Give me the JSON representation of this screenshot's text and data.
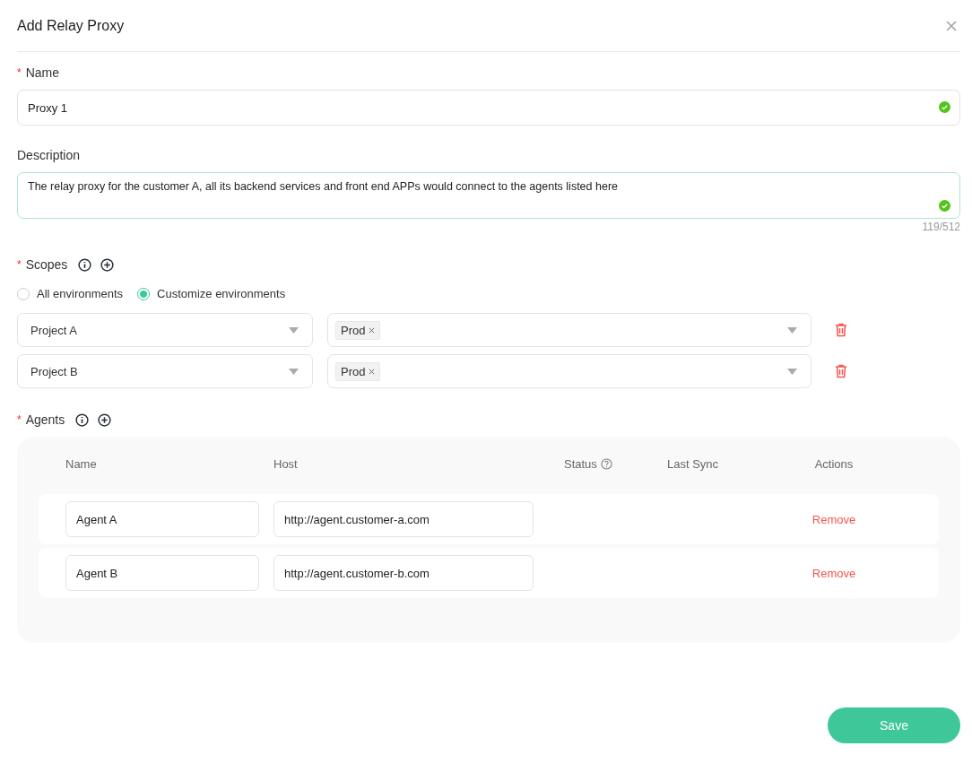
{
  "dialog": {
    "title": "Add Relay Proxy"
  },
  "name_field": {
    "label": "Name",
    "required_mark": "*",
    "value": "Proxy 1",
    "valid": true
  },
  "description_field": {
    "label": "Description",
    "value": "The relay proxy for the customer A, all its backend services and front end APPs would connect to the agents listed here",
    "valid": true,
    "counter": "119/512"
  },
  "scopes": {
    "label": "Scopes",
    "required_mark": "*",
    "options": [
      {
        "label": "All environments",
        "selected": false
      },
      {
        "label": "Customize environments",
        "selected": true
      }
    ],
    "rows": [
      {
        "project": "Project A",
        "environments": [
          "Prod"
        ]
      },
      {
        "project": "Project B",
        "environments": [
          "Prod"
        ]
      }
    ]
  },
  "agents": {
    "label": "Agents",
    "required_mark": "*",
    "columns": [
      {
        "label": "Name",
        "help": false
      },
      {
        "label": "Host",
        "help": false
      },
      {
        "label": "Status",
        "help": true
      },
      {
        "label": "Last Sync",
        "help": false
      },
      {
        "label": "Actions",
        "help": false
      }
    ],
    "rows": [
      {
        "name": "Agent A",
        "host": "http://agent.customer-a.com",
        "action": "Remove"
      },
      {
        "name": "Agent B",
        "host": "http://agent.customer-b.com",
        "action": "Remove"
      }
    ]
  },
  "save_button": "Save"
}
